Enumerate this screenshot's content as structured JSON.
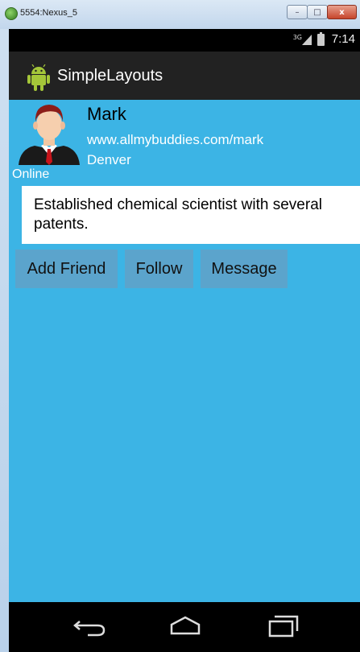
{
  "window": {
    "title": "5554:Nexus_5",
    "minimize_label": "–",
    "maximize_label": "□",
    "close_label": "x"
  },
  "statusbar": {
    "network": "3G",
    "time": "7:14"
  },
  "actionbar": {
    "title": "SimpleLayouts",
    "app_icon": "android-icon"
  },
  "profile": {
    "name": "Mark",
    "url": "www.allmybuddies.com/mark",
    "city": "Denver",
    "status": "Online",
    "bio": "Established chemical scientist with several patents."
  },
  "buttons": {
    "add_friend": "Add Friend",
    "follow": "Follow",
    "message": "Message"
  },
  "navbar": {
    "icons": [
      "back-icon",
      "home-icon",
      "recents-icon"
    ]
  },
  "colors": {
    "screen_bg": "#3cb4e5",
    "actionbar_bg": "#222222",
    "button_bg": "#5ba4cc"
  }
}
